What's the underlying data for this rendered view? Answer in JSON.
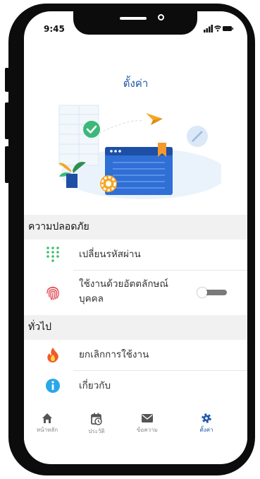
{
  "status_bar": {
    "time": "9:45"
  },
  "page": {
    "title": "ตั้งค่า"
  },
  "sections": [
    {
      "header": "ความปลอดภัย",
      "items": [
        {
          "label": "เปลี่ยนรหัสผ่าน",
          "icon": "keypad-icon"
        },
        {
          "label_line1": "ใช้งานด้วยอัตตลักษณ์",
          "label_line2": "บุคคล",
          "icon": "fingerprint-icon",
          "toggle_on": false
        }
      ]
    },
    {
      "header": "ทั่วไป",
      "items": [
        {
          "label": "ยกเลิกการใช้งาน",
          "icon": "flame-icon"
        },
        {
          "label": "เกี่ยวกับ",
          "icon": "info-icon"
        }
      ]
    }
  ],
  "tabbar": {
    "active": "ตั้งค่า",
    "tabs": [
      {
        "label": "หน้าหลัก",
        "icon": "home-icon"
      },
      {
        "label": "ประวัติ",
        "icon": "calendar-clock-icon"
      },
      {
        "label": "ข้อความ",
        "icon": "mail-icon"
      },
      {
        "label": "ตั้งค่า",
        "icon": "gear-icon"
      }
    ]
  },
  "colors": {
    "accent": "#1e58a8",
    "section_bg": "#f1f1f1",
    "keypad_green": "#3cc06a",
    "fingerprint_red": "#e34f5a",
    "flame_orange": "#f05a28",
    "info_blue": "#2aa7e8",
    "toggle_off": "#7a7a7a"
  }
}
